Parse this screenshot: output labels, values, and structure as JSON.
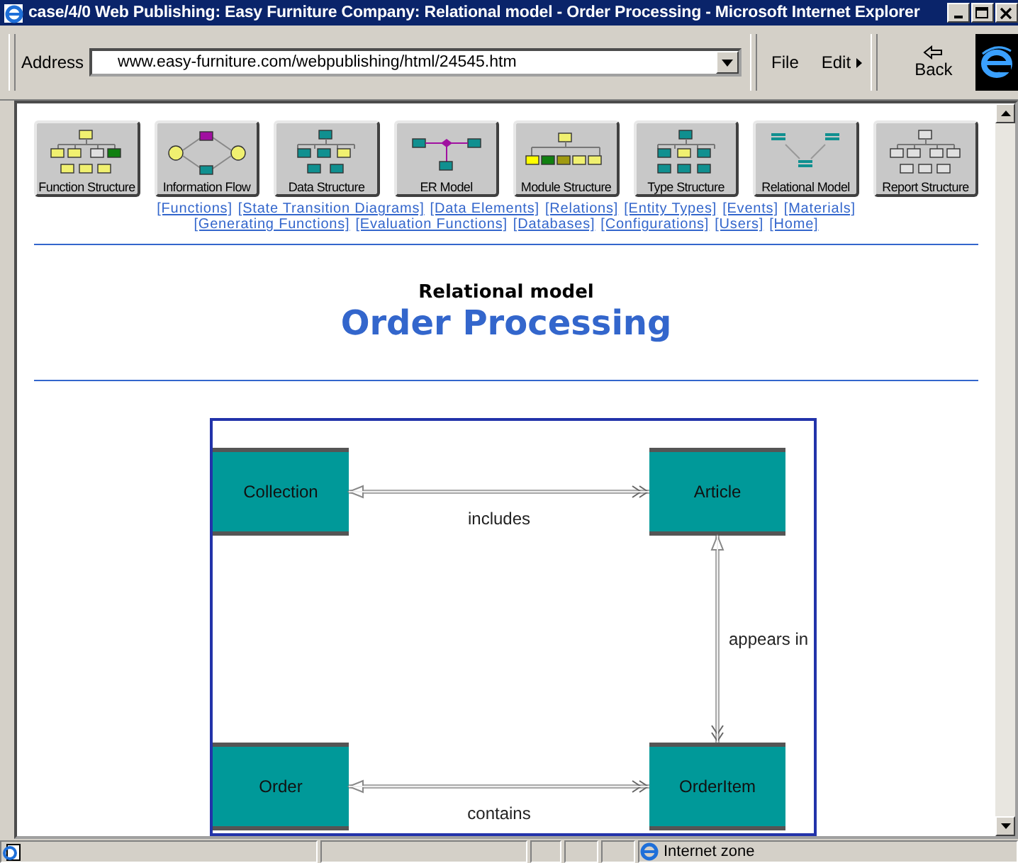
{
  "window": {
    "title": "case/4/0 Web Publishing: Easy Furniture Company: Relational model - Order Processing - Microsoft Internet Explorer"
  },
  "toolbar": {
    "address_label": "Address",
    "address": "www.easy-furniture.com/webpublishing/html/24545.htm",
    "menus": [
      "File",
      "Edit"
    ],
    "back": "Back"
  },
  "nav_buttons": [
    {
      "label": "Function Structure"
    },
    {
      "label": "Information Flow"
    },
    {
      "label": "Data Structure"
    },
    {
      "label": "ER Model"
    },
    {
      "label": "Module Structure"
    },
    {
      "label": "Type Structure"
    },
    {
      "label": "Relational Model"
    },
    {
      "label": "Report Structure"
    }
  ],
  "link_rows": [
    [
      "[Functions]",
      "[State Transition Diagrams]",
      "[Data Elements]",
      "[Relations]",
      "[Entity Types]",
      "[Events]",
      "[Materials]"
    ],
    [
      "[Generating Functions]",
      "[Evaluation Functions]",
      "[Databases]",
      "[Configurations]",
      "[Users]",
      "[Home]"
    ]
  ],
  "heading": {
    "subtitle": "Relational model",
    "title": "Order Processing"
  },
  "diagram": {
    "entities": [
      "Collection",
      "Article",
      "Order",
      "OrderItem"
    ],
    "relations": [
      {
        "label": "includes"
      },
      {
        "label": "appears in"
      },
      {
        "label": "contains"
      }
    ]
  },
  "status_bar": {
    "zone": "Internet zone"
  }
}
